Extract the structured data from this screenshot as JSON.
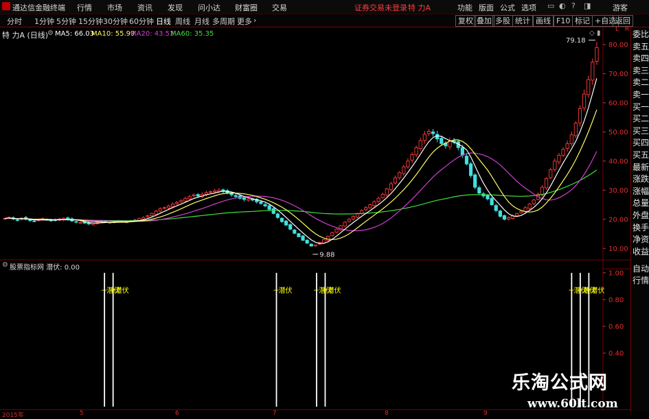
{
  "menubar": {
    "app_title": "通达信金融终端",
    "items": [
      "行情",
      "市场",
      "资讯",
      "发现",
      "问小达",
      "财富圈",
      "交易"
    ],
    "login_status": "证券交易未登录",
    "stock_name": "特 力A",
    "right_items": [
      "功能",
      "版面",
      "公式",
      "选项"
    ],
    "user": "游客"
  },
  "toolbar": {
    "periods": [
      "分时",
      "1分钟",
      "5分钟",
      "15分钟",
      "30分钟",
      "60分钟",
      "日线",
      "周线",
      "月线",
      "多周期",
      "更多"
    ],
    "active_period": "日线",
    "right_buttons": [
      "复权",
      "叠加",
      "多股",
      "统计",
      "画线",
      "F10",
      "标记",
      "+自选",
      "返回"
    ]
  },
  "chart_header": {
    "title": "特 力A (日线)",
    "ma": [
      {
        "label": "MA5: 66.03",
        "color": "#ffffff"
      },
      {
        "label": "MA10: 55.99",
        "color": "#ffff66"
      },
      {
        "label": "MA20: 43.53",
        "color": "#d040d0"
      },
      {
        "label": "MA60: 35.35",
        "color": "#40e040"
      }
    ],
    "corner_letters": "L R"
  },
  "indicator_header": {
    "title": "股票指标网 潜伏: 0.00"
  },
  "side_panel": {
    "items": [
      "委比",
      "卖五",
      "卖四",
      "卖三",
      "卖二",
      "卖一",
      "买一",
      "买二",
      "买三",
      "买四",
      "买五",
      "最新",
      "涨跌",
      "涨幅",
      "总量",
      "外盘",
      "换手",
      "净资",
      "收益"
    ],
    "bottom_items": [
      "自动",
      "行情"
    ]
  },
  "colors": {
    "up": "#ff3b3b",
    "down": "#40e0e0",
    "background": "#000000",
    "axis": "#e03030",
    "ma5": "#ffffff",
    "ma10": "#ffff66",
    "ma20": "#d040d0",
    "ma60": "#40e040",
    "signal": "#ffffff",
    "signal_label": "#ffff00"
  },
  "watermark": {
    "line1": "乐淘公式网",
    "line2": "www.60lt.com"
  },
  "chart_data": [
    {
      "type": "candlestick",
      "title": "特 力A (日线)",
      "y_axis_ticks": [
        10.0,
        20.0,
        30.0,
        40.0,
        50.0,
        60.0,
        70.0,
        80.0
      ],
      "ylim": [
        7,
        84
      ],
      "annotations": [
        {
          "label": "79.18",
          "value": 79.18,
          "kind": "high"
        },
        {
          "label": "9.88",
          "value": 9.88,
          "kind": "low"
        }
      ],
      "x_labels": [
        "2015年",
        "5",
        "6",
        "7",
        "8",
        "9"
      ],
      "closes": [
        20.3,
        20.6,
        20.1,
        19.8,
        20.4,
        20.0,
        19.6,
        19.3,
        19.8,
        20.2,
        19.9,
        19.5,
        19.7,
        20.1,
        20.4,
        19.9,
        19.4,
        19.1,
        18.9,
        18.7,
        18.4,
        18.6,
        19.0,
        19.3,
        19.1,
        18.9,
        19.2,
        19.5,
        19.3,
        19.1,
        19.4,
        19.8,
        20.2,
        20.6,
        21.2,
        22.0,
        22.8,
        23.6,
        24.0,
        24.6,
        25.2,
        25.8,
        26.5,
        27.2,
        27.8,
        28.4,
        28.0,
        28.6,
        29.2,
        29.5,
        29.8,
        30.0,
        29.6,
        29.0,
        28.4,
        27.8,
        27.2,
        26.8,
        27.0,
        26.6,
        26.0,
        25.4,
        24.6,
        23.4,
        22.0,
        20.6,
        19.2,
        18.0,
        16.6,
        15.2,
        14.0,
        12.8,
        11.8,
        10.8,
        11.2,
        12.0,
        13.0,
        14.2,
        15.4,
        16.6,
        17.8,
        19.0,
        20.0,
        21.0,
        22.0,
        23.0,
        24.0,
        25.0,
        26.0,
        27.2,
        28.6,
        30.4,
        32.2,
        34.2,
        36.0,
        38.0,
        40.0,
        42.2,
        44.6,
        47.0,
        49.2,
        50.2,
        49.4,
        47.6,
        46.0,
        45.2,
        47.0,
        46.4,
        44.6,
        42.0,
        39.0,
        35.0,
        31.0,
        29.0,
        28.0,
        27.0,
        25.0,
        23.0,
        21.0,
        20.0,
        20.6,
        21.2,
        22.0,
        22.8,
        24.0,
        25.2,
        26.6,
        28.6,
        31.0,
        34.0,
        37.0,
        40.0,
        42.0,
        44.0,
        46.0,
        49.0,
        53.0,
        58.0,
        63.0,
        68.0,
        74.0,
        79.0
      ],
      "ma": {
        "MA5": 66.03,
        "MA10": 55.99,
        "MA20": 43.53,
        "MA60": 35.35
      }
    },
    {
      "type": "bar",
      "title": "股票指标网 潜伏: 0.00",
      "y_axis_ticks": [
        0.4,
        0.6,
        0.8,
        1.0
      ],
      "ylim": [
        0,
        1.03
      ],
      "signal_label": "潜伏",
      "signal_indices": [
        35,
        38,
        95,
        109,
        112,
        198,
        201,
        204
      ],
      "bar_count": 208
    }
  ]
}
